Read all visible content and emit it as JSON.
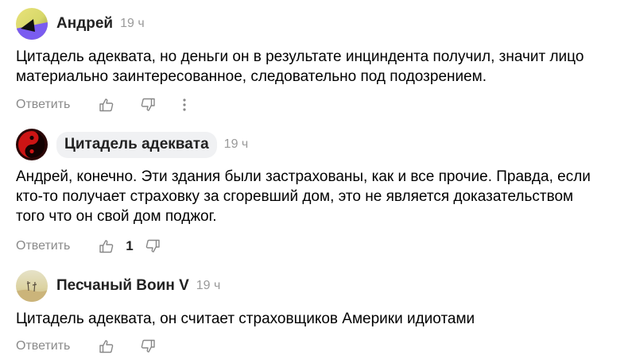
{
  "comments": [
    {
      "author": "Андрей",
      "time": "19 ч",
      "lines": [
        "Цитадель адеквата, но деньги он в результате инциндента получил, значит лицо",
        "материально заинтересованное, следовательно под подозрением."
      ],
      "reply_label": "Ответить",
      "avatar_icon": "gradient-avatar-icon"
    },
    {
      "author": "Цитадель адеквата",
      "time": "19 ч",
      "lines": [
        "Андрей, конечно. Эти здания были застрахованы, как и все прочие. Правда, если",
        "кто-то получает страховку за сгоревший дом, это не является доказательством",
        "того что он свой дом поджог."
      ],
      "reply_label": "Ответить",
      "like_count": "1",
      "avatar_icon": "yin-yang-avatar-icon"
    },
    {
      "author": "Песчаный Воин V",
      "time": "19 ч",
      "lines": [
        "Цитадель адеквата, он считает страховщиков Америки идиотами"
      ],
      "reply_label": "Ответить",
      "avatar_icon": "desert-avatar-icon"
    }
  ],
  "colors": {
    "meta_text": "#8a8a8a",
    "chip_bg": "#f0f1f3"
  }
}
